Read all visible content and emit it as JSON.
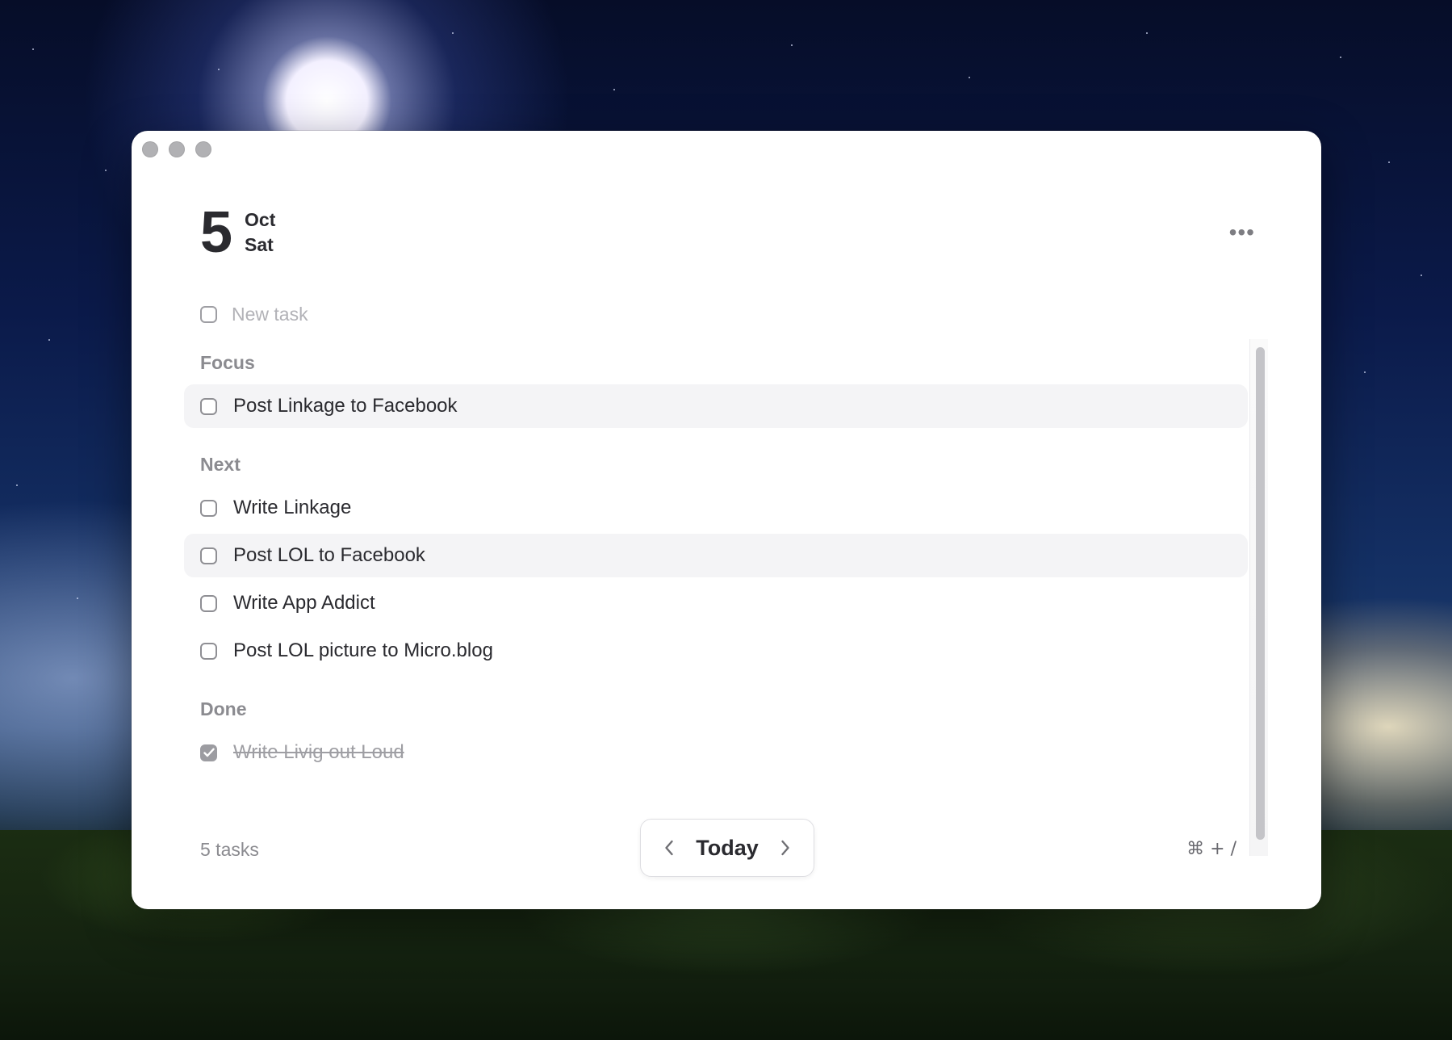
{
  "header": {
    "day_number": "5",
    "month": "Oct",
    "weekday": "Sat",
    "more_label": "•••"
  },
  "new_task": {
    "placeholder": "New task"
  },
  "sections": {
    "focus": {
      "title": "Focus",
      "tasks": [
        "Post Linkage to Facebook"
      ]
    },
    "next": {
      "title": "Next",
      "tasks": [
        "Write Linkage",
        "Post LOL to Facebook",
        "Write App Addict",
        "Post LOL picture to Micro.blog"
      ]
    },
    "done": {
      "title": "Done",
      "tasks": [
        "Write Livig out Loud"
      ]
    }
  },
  "footer": {
    "task_count": "5 tasks",
    "today_label": "Today",
    "shortcut": "⌘ + /"
  },
  "icons": {
    "traffic_lights": [
      "close-icon",
      "minimize-icon",
      "zoom-icon"
    ],
    "nav_prev": "chevron-left-icon",
    "nav_next": "chevron-right-icon",
    "check": "checkmark-icon",
    "more": "ellipsis-icon"
  },
  "colors": {
    "window_bg": "#ffffff",
    "text": "#2a2a2f",
    "section_title": "#8b8b90",
    "placeholder": "#b2b2b7",
    "highlight_row": "#f4f4f6",
    "traffic_light": "#b1b1b4"
  }
}
